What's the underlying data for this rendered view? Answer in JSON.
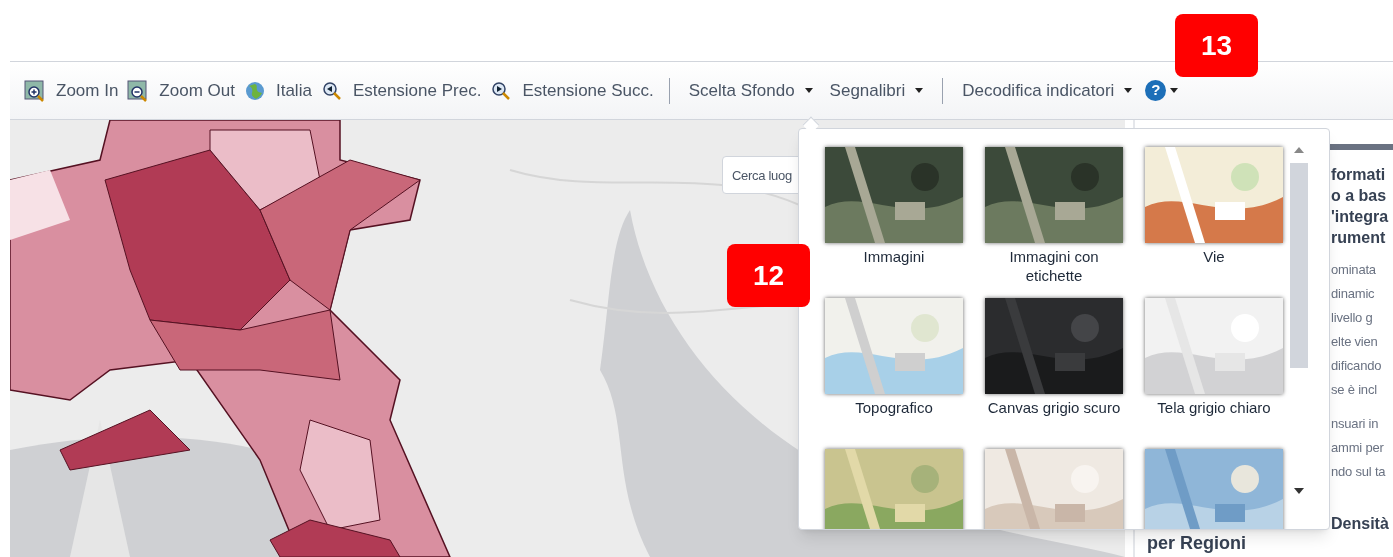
{
  "toolbar": {
    "items": [
      {
        "kind": "zoomin",
        "label": "Zoom In"
      },
      {
        "kind": "zoomout",
        "label": "Zoom Out"
      },
      {
        "kind": "globe",
        "label": "Italia"
      },
      {
        "kind": "prev",
        "label": "Estensione Prec."
      },
      {
        "kind": "next",
        "label": "Estensione Succ."
      },
      {
        "kind": "separator"
      },
      {
        "kind": "menu",
        "label": "Scelta Sfondo"
      },
      {
        "kind": "menu",
        "label": "Segnalibri"
      },
      {
        "kind": "separator"
      },
      {
        "kind": "menu",
        "label": "Decodifica indicatori"
      },
      {
        "kind": "help",
        "label": "?"
      }
    ]
  },
  "badges": [
    {
      "label": "13"
    },
    {
      "label": "12"
    }
  ],
  "map": {
    "search": {
      "placeholder": "Cerca luog"
    }
  },
  "basemap_gallery": {
    "items": [
      {
        "kind": "imagery",
        "label": "Immagini"
      },
      {
        "kind": "imagery",
        "label": "Immagini con etichette"
      },
      {
        "kind": "streets",
        "label": "Vie"
      },
      {
        "kind": "topo",
        "label": "Topografico"
      },
      {
        "kind": "dark",
        "label": "Canvas grigio scuro"
      },
      {
        "kind": "light",
        "label": "Tela grigio chiaro"
      },
      {
        "kind": "terrain"
      },
      {
        "kind": "relief"
      },
      {
        "kind": "ocean"
      }
    ]
  },
  "side_panel": {
    "lines": [
      {
        "kind": "bold",
        "text": "formati"
      },
      {
        "kind": "bold",
        "text": "o a bas"
      },
      {
        "kind": "bold",
        "text": "'integra"
      },
      {
        "kind": "bold",
        "text": "rument"
      },
      {
        "kind": "gap"
      },
      {
        "kind": "normal",
        "text": "ominata"
      },
      {
        "kind": "normal",
        "text": "dinamic"
      },
      {
        "kind": "normal",
        "text": "livello g"
      },
      {
        "kind": "normal",
        "text": "elte vien"
      },
      {
        "kind": "normal",
        "text": "dificando"
      },
      {
        "kind": "normal",
        "text": "se è incl"
      },
      {
        "kind": "gap"
      },
      {
        "kind": "normal",
        "text": "nsuari in"
      },
      {
        "kind": "normal",
        "text": "ammi per"
      },
      {
        "kind": "normal",
        "text": "ndo sul ta"
      }
    ],
    "heading_end": "Densità",
    "heading_line2": "per Regioni"
  }
}
